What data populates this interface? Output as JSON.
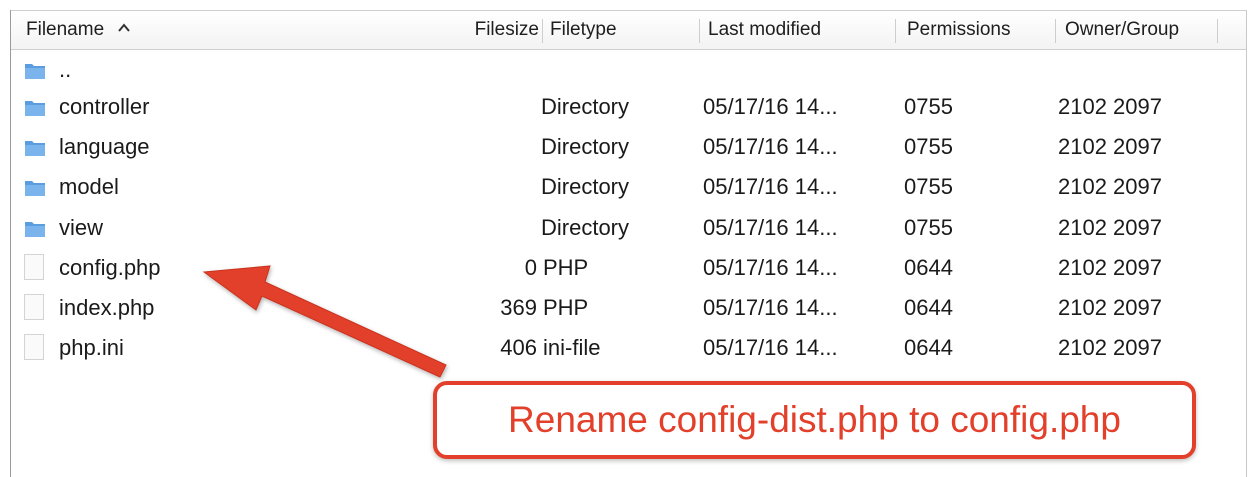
{
  "columns": {
    "filename": "Filename",
    "filesize": "Filesize",
    "filetype": "Filetype",
    "last_modified": "Last modified",
    "permissions": "Permissions",
    "owner_group": "Owner/Group"
  },
  "sort": {
    "column": "filename",
    "direction": "ascending",
    "indicator_icon": "chevron-up-icon"
  },
  "rows": [
    {
      "icon": "folder-icon",
      "name": "..",
      "size": "",
      "type": "",
      "modified": "",
      "perms": "",
      "owner": ""
    },
    {
      "icon": "folder-icon",
      "name": "controller",
      "size": "",
      "type": "Directory",
      "modified": "05/17/16 14...",
      "perms": "0755",
      "owner": "2102 2097"
    },
    {
      "icon": "folder-icon",
      "name": "language",
      "size": "",
      "type": "Directory",
      "modified": "05/17/16 14...",
      "perms": "0755",
      "owner": "2102 2097"
    },
    {
      "icon": "folder-icon",
      "name": "model",
      "size": "",
      "type": "Directory",
      "modified": "05/17/16 14...",
      "perms": "0755",
      "owner": "2102 2097"
    },
    {
      "icon": "folder-icon",
      "name": "view",
      "size": "",
      "type": "Directory",
      "modified": "05/17/16 14...",
      "perms": "0755",
      "owner": "2102 2097"
    },
    {
      "icon": "file-icon",
      "name": "config.php",
      "size": "0",
      "type": "PHP",
      "modified": "05/17/16 14...",
      "perms": "0644",
      "owner": "2102 2097"
    },
    {
      "icon": "file-icon",
      "name": "index.php",
      "size": "369",
      "type": "PHP",
      "modified": "05/17/16 14...",
      "perms": "0644",
      "owner": "2102 2097"
    },
    {
      "icon": "file-icon",
      "name": "php.ini",
      "size": "406",
      "type": "ini-file",
      "modified": "05/17/16 14...",
      "perms": "0644",
      "owner": "2102 2097"
    }
  ],
  "annotation": {
    "text": "Rename config-dist.php to config.php",
    "color": "#e2402a"
  },
  "colors": {
    "folder_icon": "#5a9ee0",
    "annotation": "#e2402a"
  }
}
